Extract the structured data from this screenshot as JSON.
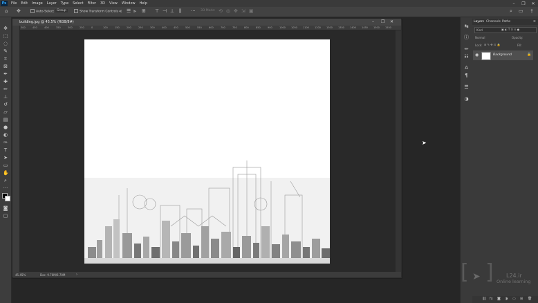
{
  "menubar": {
    "logo": "Ps",
    "items": [
      "File",
      "Edit",
      "Image",
      "Layer",
      "Type",
      "Select",
      "Filter",
      "3D",
      "View",
      "Window",
      "Help"
    ]
  },
  "options": {
    "auto_select": "Auto-Select",
    "group": "Group",
    "transform": "Show Transform Controls",
    "mode3d": "3D Mode:"
  },
  "document": {
    "title": "building.jpg @ 45.5% (RGB/8#)",
    "zoom": "45.45%",
    "doc_info": "Doc: 9.70M/6.70M",
    "ruler_ticks": [
      "300",
      "450",
      "400",
      "350",
      "300",
      "250",
      "0",
      "100",
      "150",
      "200",
      "250",
      "300",
      "400",
      "450",
      "500",
      "550",
      "600",
      "700",
      "750",
      "800",
      "850",
      "900",
      "1000",
      "1050",
      "1100",
      "1200",
      "1300",
      "1350",
      "1400",
      "1450",
      "1500",
      "1550"
    ]
  },
  "layers_panel": {
    "tabs": [
      "Layers",
      "Channels",
      "Paths"
    ],
    "kind_placeholder": "Kind",
    "blend_mode": "Normal",
    "opacity_label": "Opacity:",
    "lock_label": "Lock:",
    "fill_label": "Fill:",
    "layer_name": "Background"
  },
  "watermark": {
    "site": "L24.ir",
    "subtitle": "Online learning"
  }
}
